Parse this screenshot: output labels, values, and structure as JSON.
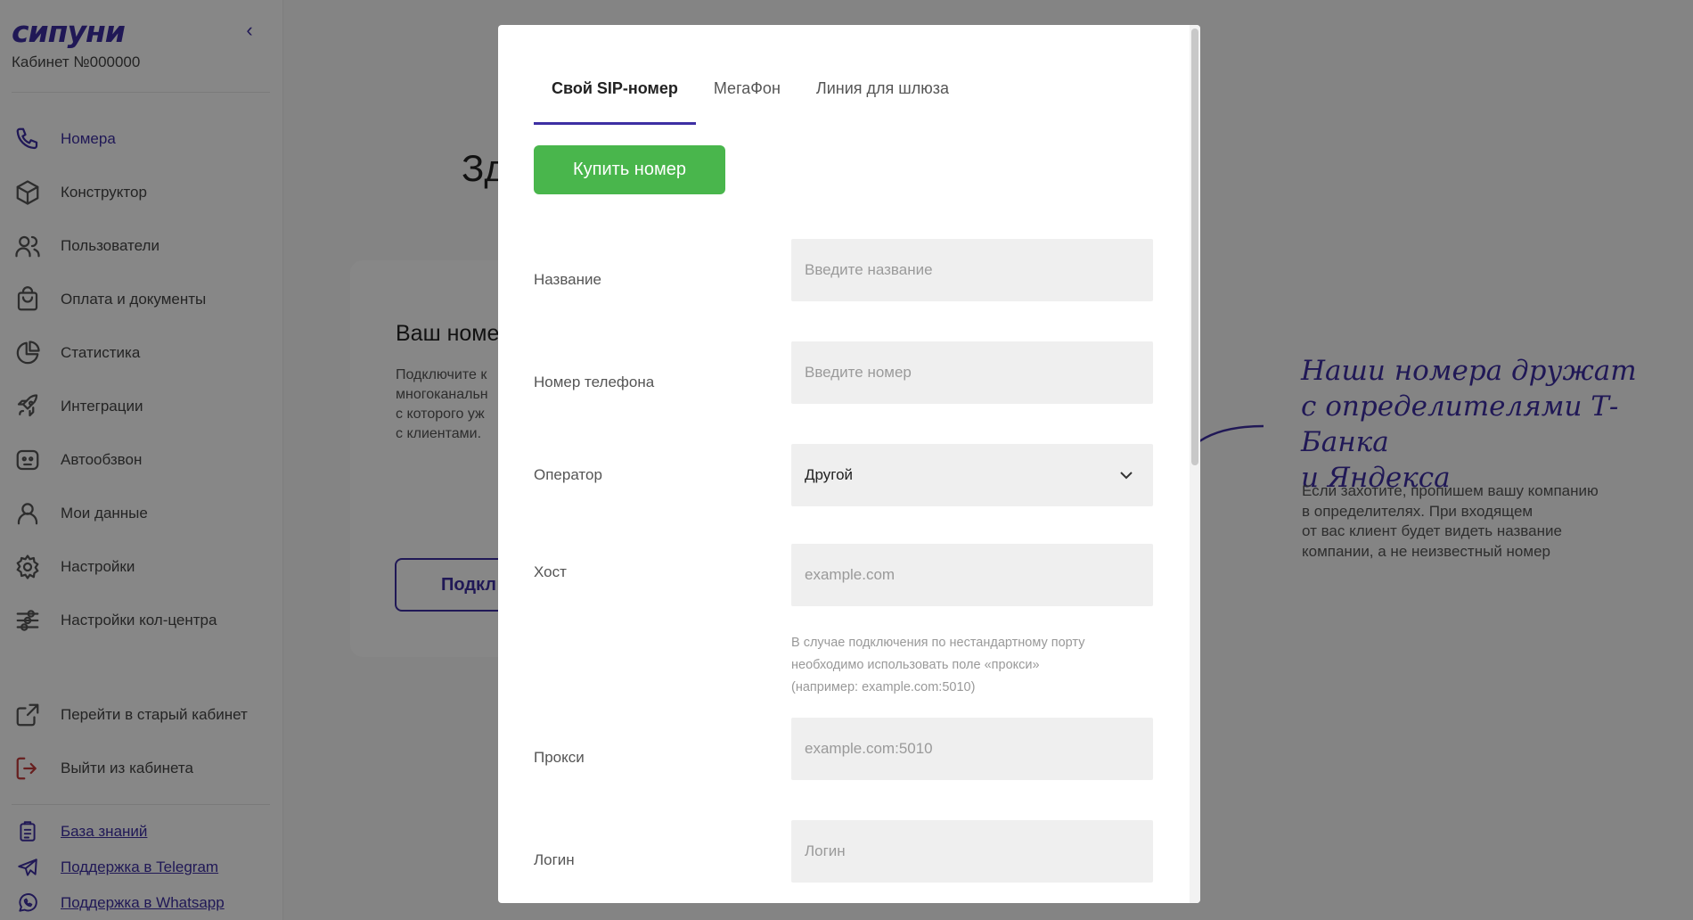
{
  "sidebar": {
    "logo": "сипуни",
    "cabinet": "Кабинет №000000",
    "nav": [
      {
        "label": "Номера",
        "icon": "phone-icon"
      },
      {
        "label": "Конструктор",
        "icon": "cube-icon"
      },
      {
        "label": "Пользователи",
        "icon": "users-icon"
      },
      {
        "label": "Оплата и документы",
        "icon": "shopping-bag-icon"
      },
      {
        "label": "Статистика",
        "icon": "pie-chart-icon"
      },
      {
        "label": "Интеграции",
        "icon": "rocket-icon"
      },
      {
        "label": "Автообзвон",
        "icon": "robot-icon"
      },
      {
        "label": "Мои данные",
        "icon": "user-icon"
      },
      {
        "label": "Настройки",
        "icon": "gear-icon"
      },
      {
        "label": "Настройки кол-центра",
        "icon": "sliders-icon"
      }
    ],
    "old_cabinet": "Перейти в старый кабинет",
    "logout": "Выйти из кабинета",
    "links": [
      {
        "label": "База знаний",
        "icon": "clipboard-icon"
      },
      {
        "label": "Поддержка в Telegram",
        "icon": "telegram-icon"
      },
      {
        "label": "Поддержка в Whatsapp",
        "icon": "whatsapp-icon"
      }
    ]
  },
  "page": {
    "title_partial": "Зд",
    "card_title_partial": "Ваш номе",
    "card_text_partial": "Подключите к\nмногоканальн\nс которого уж\nс клиентами.",
    "card_button_partial": "Подкл",
    "promo_title": "Наши номера дружат\nс определителями Т-Банка\nи Яндекса",
    "promo_text": "Если захотите, пропишем вашу компанию\nв определителях. При входящем\nот вас клиент будет видеть название\nкомпании, а не неизвестный номер"
  },
  "modal": {
    "tabs": [
      "Свой SIP-номер",
      "МегаФон",
      "Линия для шлюза"
    ],
    "active_tab": "Свой SIP-номер",
    "buy_button": "Купить номер",
    "fields": {
      "name": {
        "label": "Название",
        "placeholder": "Введите название"
      },
      "phone": {
        "label": "Номер телефона",
        "placeholder": "Введите номер"
      },
      "operator": {
        "label": "Оператор",
        "value": "Другой"
      },
      "host": {
        "label": "Хост",
        "placeholder": "example.com"
      },
      "host_hint": "В случае подключения по нестандартному порту\nнеобходимо использовать поле «прокси»\n(например: example.com:5010)",
      "proxy": {
        "label": "Прокси",
        "placeholder": "example.com:5010"
      },
      "login": {
        "label": "Логин",
        "placeholder": "Логин"
      }
    }
  },
  "colors": {
    "accent": "#3d2fa3",
    "buy_button": "#49b64c",
    "logout": "#c23b3b",
    "overlay": "rgba(0,0,0,0.47)"
  }
}
